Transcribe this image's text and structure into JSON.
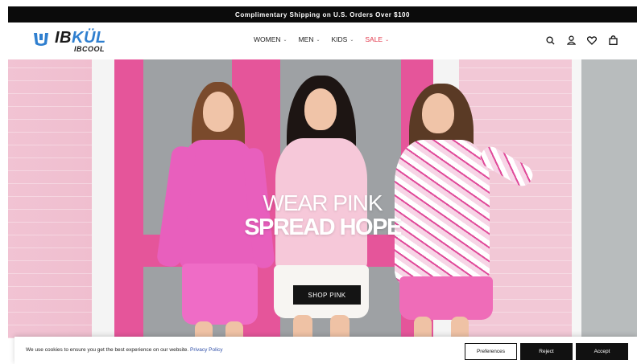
{
  "announcement": {
    "text": "Complimentary Shipping on U.S. Orders Over $100"
  },
  "header": {
    "logo": {
      "main_prefix": "IB",
      "main_accent": "KÜL",
      "sub": "IBCOOL"
    },
    "nav": [
      {
        "label": "WOMEN"
      },
      {
        "label": "MEN"
      },
      {
        "label": "KIDS"
      },
      {
        "label": "SALE"
      }
    ],
    "icons": [
      "search-icon",
      "account-icon",
      "wishlist-icon",
      "cart-icon"
    ]
  },
  "hero": {
    "line1": "WEAR PINK",
    "line2": "SPREAD HOPE",
    "cta": "SHOP PINK"
  },
  "cookie_banner": {
    "message": "We use cookies to ensure you get the best experience on our website.",
    "link": "Privacy Policy",
    "buttons": {
      "preferences": "Preferences",
      "reject": "Reject",
      "accept": "Accept"
    }
  },
  "colors": {
    "sale": "#e23a4d",
    "brand_blue": "#2f7fcf",
    "door_pink": "#e5559a"
  }
}
